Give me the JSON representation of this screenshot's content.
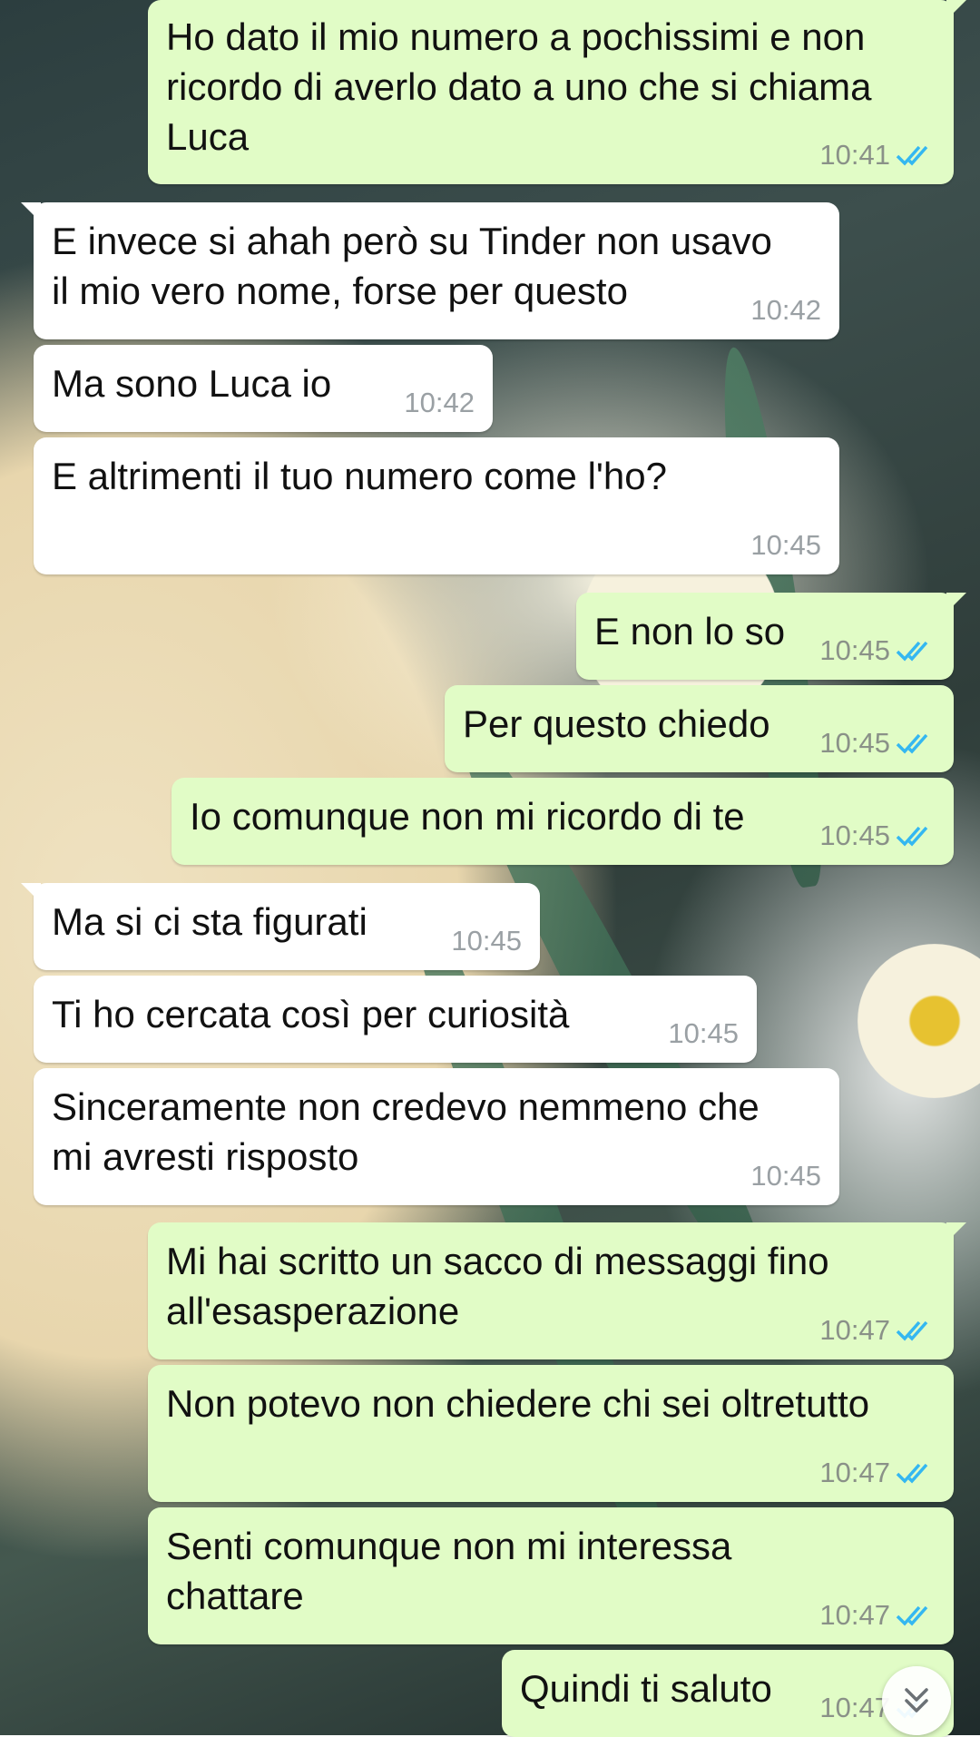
{
  "colors": {
    "outgoing_bubble": "#e1fcc6",
    "incoming_bubble": "#ffffff",
    "read_tick": "#34b7f1",
    "timestamp": "#8a9188"
  },
  "messages": [
    {
      "direction": "out",
      "text": "Ho dato il mio numero a pochissimi e non\nricordo di averlo dato a uno che si chiama\nLuca",
      "time": "10:41",
      "status": "read"
    },
    {
      "direction": "in",
      "text": "E invece si ahah però su Tinder non usavo\nil mio vero nome, forse per questo",
      "time": "10:42"
    },
    {
      "direction": "in",
      "text": "Ma sono Luca io",
      "time": "10:42"
    },
    {
      "direction": "in",
      "text": "E altrimenti il tuo numero come l'ho?",
      "time": "10:45"
    },
    {
      "direction": "out",
      "text": "E non lo so",
      "time": "10:45",
      "status": "read"
    },
    {
      "direction": "out",
      "text": "Per questo chiedo",
      "time": "10:45",
      "status": "read"
    },
    {
      "direction": "out",
      "text": "Io comunque non mi ricordo di te",
      "time": "10:45",
      "status": "read"
    },
    {
      "direction": "in",
      "text": "Ma si ci sta figurati",
      "time": "10:45"
    },
    {
      "direction": "in",
      "text": "Ti ho cercata così per curiosità",
      "time": "10:45"
    },
    {
      "direction": "in",
      "text": "Sinceramente non credevo nemmeno che\nmi avresti risposto",
      "time": "10:45"
    },
    {
      "direction": "out",
      "text": "Mi hai scritto un sacco di messaggi fino\nall'esasperazione",
      "time": "10:47",
      "status": "read"
    },
    {
      "direction": "out",
      "text": "Non potevo non chiedere chi sei oltretutto",
      "time": "10:47",
      "status": "read"
    },
    {
      "direction": "out",
      "text": "Senti comunque non mi interessa\nchattare",
      "time": "10:47",
      "status": "read"
    },
    {
      "direction": "out",
      "text": "Quindi ti saluto",
      "time": "10:47",
      "status": "read"
    }
  ],
  "scroll_button": {
    "icon": "double-chevron-down-icon"
  }
}
